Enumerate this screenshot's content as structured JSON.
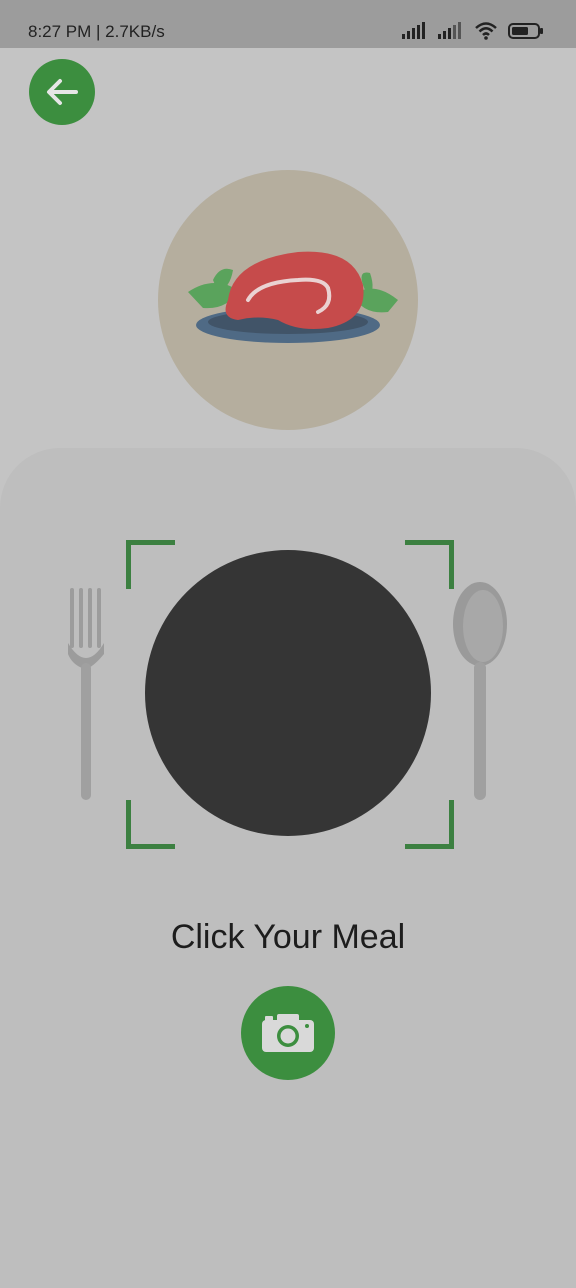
{
  "status_bar": {
    "time_speed": "8:27 PM | 2.7KB/s",
    "icons": [
      "signal-icon",
      "signal-icon",
      "wifi-icon",
      "battery-icon"
    ]
  },
  "header": {
    "back_icon": "arrow-left-icon"
  },
  "meal_image": {
    "icon": "steak-plate-icon"
  },
  "scan": {
    "caption": "Click Your Meal",
    "camera_icon": "camera-icon"
  },
  "colors": {
    "accent": "#3c8e3f",
    "background": "#c4c4c4",
    "plate": "#353535",
    "frame": "#3c8041"
  }
}
